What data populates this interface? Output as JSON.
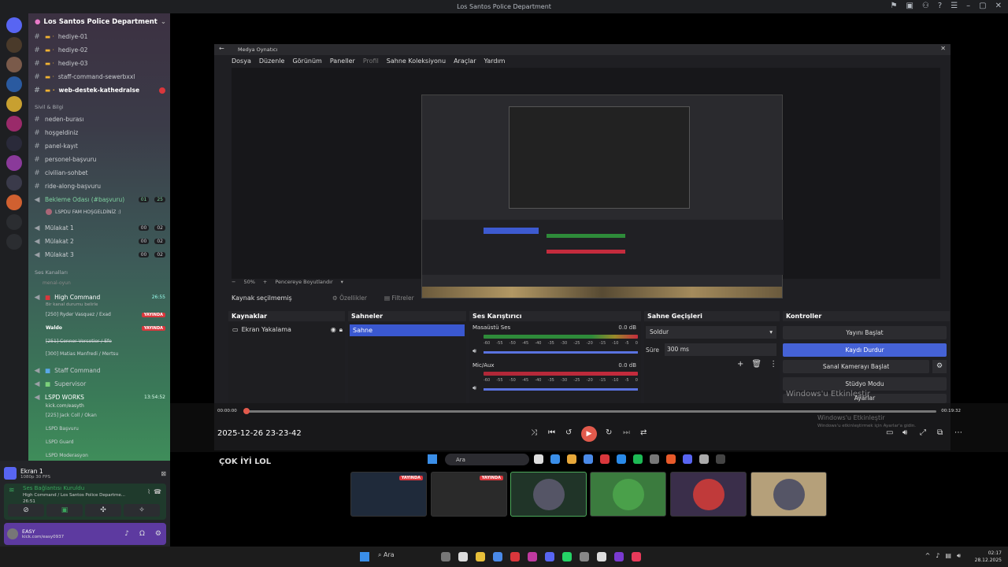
{
  "window_title": "Los Santos Police Department",
  "sidebar": {
    "guild_name": "Los Santos Police Department",
    "text_channels": [
      {
        "name": "hediye-01",
        "prefix": "▬ ·"
      },
      {
        "name": "hediye-02",
        "prefix": "▬ ·"
      },
      {
        "name": "hediye-03",
        "prefix": "▬ ·"
      },
      {
        "name": "staff-command-sewerbxxl",
        "prefix": "▬ ·"
      },
      {
        "name": "web-destek-kathedralse",
        "prefix": "▬ ·"
      }
    ],
    "category_sivil": "Sivil & Bilgi",
    "sivil_channels": [
      "neden-burası",
      "hoşgeldiniz",
      "panel-kayıt",
      "personel-başvuru",
      "civilian-sohbet",
      "ride-along-başvuru"
    ],
    "waiting_room": "Bekleme Odası (#başvuru)",
    "waiting_room_count1": "01",
    "waiting_room_count2": "25",
    "waiting_user": "LSPDU FAM HOŞGELDİNİZ :)",
    "interviews": [
      {
        "name": "Mülakat 1",
        "a": "00",
        "b": "02"
      },
      {
        "name": "Mülakat 2",
        "a": "00",
        "b": "02"
      },
      {
        "name": "Mülakat 3",
        "a": "00",
        "b": "02"
      }
    ],
    "category_voice": "Ses Kanalları",
    "voice_sub": "menal-oyun",
    "high_command": "High Command",
    "high_command_time": "26:55",
    "high_command_status": "Bir kanal durumu belirle",
    "yayinda": "YAYINDA",
    "hc_members": [
      "[250] Ryder Vasquez / Exad",
      "Waldo",
      "[251] Connor Vercetier / Efe",
      "[300] Matias Manfredi / Mertsu"
    ],
    "staff_command": "Staff Command",
    "supervisor": "Supervisor",
    "lspd_works": "LSPD WORKS",
    "lspd_works_time": "13:54:52",
    "lspd_works_link": "kick.com/easyth",
    "lspd_sub": [
      "[225] Jack Coll / Okan",
      "LSPD Başvuru",
      "LSPD Guard",
      "LSPD Moderasyon"
    ]
  },
  "user_area": {
    "stream_name": "Ekran 1",
    "stream_quality": "1080p 30 FPS",
    "voice_connected": "Ses Bağlantısı Kuruldu",
    "voice_channel": "High Command / Los Santos Police Departme...",
    "voice_time": "26:51",
    "username": "EASY",
    "user_status": "kick.com/easy0937"
  },
  "obs": {
    "app_title": "Medya Oynatıcı",
    "menu": [
      "Dosya",
      "Düzenle",
      "Görünüm",
      "Paneller",
      "Profil",
      "Sahne Koleksiyonu",
      "Araçlar",
      "Yardım"
    ],
    "zoom": "50%",
    "fit_label": "Pencereye Boyutlandır",
    "no_source": "Kaynak seçilmemiş",
    "properties": "Özellikler",
    "filters": "Filtreler",
    "docks": {
      "sources": "Kaynaklar",
      "scenes": "Sahneler",
      "mixer": "Ses Karıştırıcı",
      "transitions": "Sahne Geçişleri",
      "controls": "Kontroller"
    },
    "source_item": "Ekran Yakalama",
    "scene_item": "Sahne",
    "mixer_ch1": "Masaüstü Ses",
    "mixer_ch1_db": "0.0 dB",
    "mixer_ch2": "Mic/Aux",
    "mixer_ch2_db": "0.0 dB",
    "meter_ticks": [
      "-60",
      "-55",
      "-50",
      "-45",
      "-40",
      "-35",
      "-30",
      "-25",
      "-20",
      "-15",
      "-10",
      "-5",
      "0"
    ],
    "transition": "Soldur",
    "duration_label": "Süre",
    "duration_value": "300 ms",
    "controls": [
      "Yayını Başlat",
      "Kaydı Durdur",
      "Sanal Kamerayı Başlat",
      "Stüdyo Modu",
      "Ayarlar"
    ]
  },
  "player": {
    "time_current": "00:00:00",
    "time_total": "00:19:32",
    "date_label": "2025-12-26 23-23-42"
  },
  "windows_activate": {
    "title": "Windows'u Etkinleştir",
    "sub": "Windows'u etkinleştirmek için Ayarlar'a gidin."
  },
  "overlay_text": "ÇOK İYİ LOL",
  "overlay_search": "Ara",
  "taskbar": {
    "search": "Ara",
    "time": "02:17",
    "date": "28.12.2025"
  },
  "colors": {
    "discord_blurple": "#5865f2",
    "obs_active": "#4562d6",
    "live_red": "#da373c",
    "meter_green": "#2e8b3a",
    "meter_red": "#c42b3d"
  }
}
